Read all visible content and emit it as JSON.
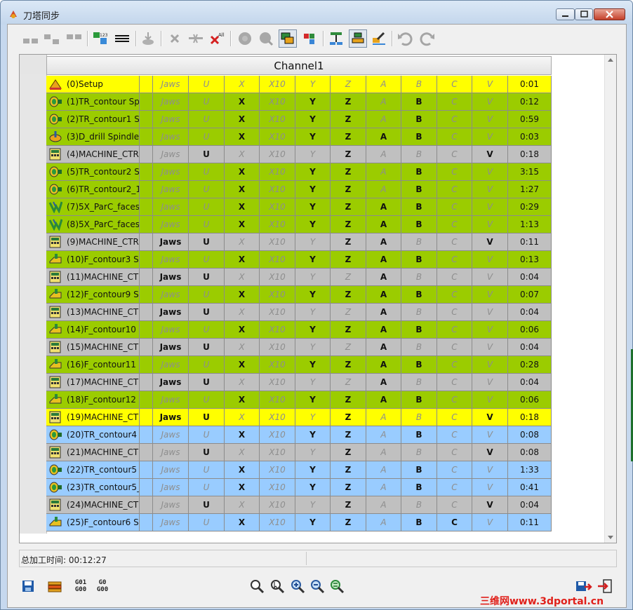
{
  "window": {
    "title": "刀塔同步"
  },
  "grid": {
    "channel_header": "Channel1",
    "rows": [
      {
        "color": "yellow",
        "icon": "setup-icon",
        "name": "(0)Setup",
        "cols": [
          "",
          "Jaws",
          "U",
          "X",
          "X10",
          "Y",
          "Z",
          "A",
          "B",
          "C",
          "V"
        ],
        "on": [
          0,
          0,
          0,
          0,
          0,
          0,
          0,
          0,
          0,
          0,
          0
        ],
        "time": "0:01"
      },
      {
        "color": "green",
        "icon": "turning-icon",
        "name": "(1)TR_contour  Sp",
        "cols": [
          "",
          "Jaws",
          "U",
          "X",
          "X10",
          "Y",
          "Z",
          "A",
          "B",
          "C",
          "V"
        ],
        "on": [
          0,
          0,
          0,
          1,
          0,
          1,
          1,
          0,
          1,
          0,
          0
        ],
        "time": "0:12"
      },
      {
        "color": "green",
        "icon": "turning-icon",
        "name": "(2)TR_contour1  S",
        "cols": [
          "",
          "Jaws",
          "U",
          "X",
          "X10",
          "Y",
          "Z",
          "A",
          "B",
          "C",
          "V"
        ],
        "on": [
          0,
          0,
          0,
          1,
          0,
          1,
          1,
          0,
          1,
          0,
          0
        ],
        "time": "0:59"
      },
      {
        "color": "green",
        "icon": "drill-icon",
        "name": "(3)D_drill  Spindle",
        "cols": [
          "",
          "Jaws",
          "U",
          "X",
          "X10",
          "Y",
          "Z",
          "A",
          "B",
          "C",
          "V"
        ],
        "on": [
          0,
          0,
          0,
          1,
          0,
          1,
          1,
          1,
          1,
          0,
          0
        ],
        "time": "0:03"
      },
      {
        "color": "gray",
        "icon": "machine-control-icon",
        "name": "(4)MACHINE_CTR",
        "cols": [
          "",
          "Jaws",
          "U",
          "X",
          "X10",
          "Y",
          "Z",
          "A",
          "B",
          "C",
          "V"
        ],
        "on": [
          0,
          0,
          1,
          0,
          0,
          0,
          1,
          0,
          0,
          0,
          1
        ],
        "time": "0:18"
      },
      {
        "color": "green",
        "icon": "turning-icon",
        "name": "(5)TR_contour2  S",
        "cols": [
          "",
          "Jaws",
          "U",
          "X",
          "X10",
          "Y",
          "Z",
          "A",
          "B",
          "C",
          "V"
        ],
        "on": [
          0,
          0,
          0,
          1,
          0,
          1,
          1,
          0,
          1,
          0,
          0
        ],
        "time": "3:15"
      },
      {
        "color": "green",
        "icon": "turning-icon",
        "name": "(6)TR_contour2_1",
        "cols": [
          "",
          "Jaws",
          "U",
          "X",
          "X10",
          "Y",
          "Z",
          "A",
          "B",
          "C",
          "V"
        ],
        "on": [
          0,
          0,
          0,
          1,
          0,
          1,
          1,
          0,
          1,
          0,
          0
        ],
        "time": "1:27"
      },
      {
        "color": "green",
        "icon": "five-axis-icon",
        "name": "(7)5X_ParC_faces",
        "cols": [
          "",
          "Jaws",
          "U",
          "X",
          "X10",
          "Y",
          "Z",
          "A",
          "B",
          "C",
          "V"
        ],
        "on": [
          0,
          0,
          0,
          1,
          0,
          1,
          1,
          1,
          1,
          0,
          0
        ],
        "time": "0:29"
      },
      {
        "color": "green",
        "icon": "five-axis-icon",
        "name": "(8)5X_ParC_faces",
        "cols": [
          "",
          "Jaws",
          "U",
          "X",
          "X10",
          "Y",
          "Z",
          "A",
          "B",
          "C",
          "V"
        ],
        "on": [
          0,
          0,
          0,
          1,
          0,
          1,
          1,
          1,
          1,
          0,
          0
        ],
        "time": "1:13"
      },
      {
        "color": "gray",
        "icon": "machine-control-icon",
        "name": "(9)MACHINE_CTR",
        "cols": [
          "",
          "Jaws",
          "U",
          "X",
          "X10",
          "Y",
          "Z",
          "A",
          "B",
          "C",
          "V"
        ],
        "on": [
          0,
          1,
          1,
          0,
          0,
          0,
          1,
          1,
          0,
          0,
          1
        ],
        "time": "0:11"
      },
      {
        "color": "green",
        "icon": "milling-icon",
        "name": "(10)F_contour3  S",
        "cols": [
          "",
          "Jaws",
          "U",
          "X",
          "X10",
          "Y",
          "Z",
          "A",
          "B",
          "C",
          "V"
        ],
        "on": [
          0,
          0,
          0,
          1,
          0,
          1,
          1,
          1,
          1,
          0,
          0
        ],
        "time": "0:13"
      },
      {
        "color": "gray",
        "icon": "machine-control-icon",
        "name": "(11)MACHINE_CT",
        "cols": [
          "",
          "Jaws",
          "U",
          "X",
          "X10",
          "Y",
          "Z",
          "A",
          "B",
          "C",
          "V"
        ],
        "on": [
          0,
          1,
          1,
          0,
          0,
          0,
          0,
          1,
          0,
          0,
          0
        ],
        "time": "0:04"
      },
      {
        "color": "green",
        "icon": "milling-icon",
        "name": "(12)F_contour9  S",
        "cols": [
          "",
          "Jaws",
          "U",
          "X",
          "X10",
          "Y",
          "Z",
          "A",
          "B",
          "C",
          "V"
        ],
        "on": [
          0,
          0,
          0,
          1,
          0,
          1,
          1,
          1,
          1,
          0,
          0
        ],
        "time": "0:07"
      },
      {
        "color": "gray",
        "icon": "machine-control-icon",
        "name": "(13)MACHINE_CT",
        "cols": [
          "",
          "Jaws",
          "U",
          "X",
          "X10",
          "Y",
          "Z",
          "A",
          "B",
          "C",
          "V"
        ],
        "on": [
          0,
          1,
          1,
          0,
          0,
          0,
          0,
          1,
          0,
          0,
          0
        ],
        "time": "0:04"
      },
      {
        "color": "green",
        "icon": "milling-icon",
        "name": "(14)F_contour10",
        "cols": [
          "",
          "Jaws",
          "U",
          "X",
          "X10",
          "Y",
          "Z",
          "A",
          "B",
          "C",
          "V"
        ],
        "on": [
          0,
          0,
          0,
          1,
          0,
          1,
          1,
          1,
          1,
          0,
          0
        ],
        "time": "0:06"
      },
      {
        "color": "gray",
        "icon": "machine-control-icon",
        "name": "(15)MACHINE_CT",
        "cols": [
          "",
          "Jaws",
          "U",
          "X",
          "X10",
          "Y",
          "Z",
          "A",
          "B",
          "C",
          "V"
        ],
        "on": [
          0,
          1,
          1,
          0,
          0,
          0,
          0,
          1,
          0,
          0,
          0
        ],
        "time": "0:04"
      },
      {
        "color": "green",
        "icon": "milling-icon",
        "name": "(16)F_contour11",
        "cols": [
          "",
          "Jaws",
          "U",
          "X",
          "X10",
          "Y",
          "Z",
          "A",
          "B",
          "C",
          "V"
        ],
        "on": [
          0,
          0,
          0,
          1,
          0,
          1,
          1,
          1,
          1,
          0,
          0
        ],
        "time": "0:28"
      },
      {
        "color": "gray",
        "icon": "machine-control-icon",
        "name": "(17)MACHINE_CT",
        "cols": [
          "",
          "Jaws",
          "U",
          "X",
          "X10",
          "Y",
          "Z",
          "A",
          "B",
          "C",
          "V"
        ],
        "on": [
          0,
          1,
          1,
          0,
          0,
          0,
          0,
          1,
          0,
          0,
          0
        ],
        "time": "0:04"
      },
      {
        "color": "green",
        "icon": "milling-icon",
        "name": "(18)F_contour12",
        "cols": [
          "",
          "Jaws",
          "U",
          "X",
          "X10",
          "Y",
          "Z",
          "A",
          "B",
          "C",
          "V"
        ],
        "on": [
          0,
          0,
          0,
          1,
          0,
          1,
          1,
          1,
          1,
          0,
          0
        ],
        "time": "0:06"
      },
      {
        "color": "yellow",
        "icon": "machine-control-icon",
        "name": "(19)MACHINE_CT",
        "cols": [
          "",
          "Jaws",
          "U",
          "X",
          "X10",
          "Y",
          "Z",
          "A",
          "B",
          "C",
          "V"
        ],
        "on": [
          0,
          1,
          1,
          0,
          0,
          0,
          1,
          0,
          0,
          0,
          1
        ],
        "time": "0:18"
      },
      {
        "color": "blue",
        "icon": "turning-icon",
        "name": "(20)TR_contour4",
        "cols": [
          "",
          "Jaws",
          "U",
          "X",
          "X10",
          "Y",
          "Z",
          "A",
          "B",
          "C",
          "V"
        ],
        "on": [
          0,
          0,
          0,
          1,
          0,
          1,
          1,
          0,
          1,
          0,
          0
        ],
        "time": "0:08"
      },
      {
        "color": "gray",
        "icon": "machine-control-icon",
        "name": "(21)MACHINE_CT",
        "cols": [
          "",
          "Jaws",
          "U",
          "X",
          "X10",
          "Y",
          "Z",
          "A",
          "B",
          "C",
          "V"
        ],
        "on": [
          0,
          0,
          1,
          0,
          0,
          0,
          1,
          0,
          0,
          0,
          1
        ],
        "time": "0:08"
      },
      {
        "color": "blue",
        "icon": "turning-icon",
        "name": "(22)TR_contour5",
        "cols": [
          "",
          "Jaws",
          "U",
          "X",
          "X10",
          "Y",
          "Z",
          "A",
          "B",
          "C",
          "V"
        ],
        "on": [
          0,
          0,
          0,
          1,
          0,
          1,
          1,
          0,
          1,
          0,
          0
        ],
        "time": "1:33"
      },
      {
        "color": "blue",
        "icon": "turning-icon",
        "name": "(23)TR_contour5_",
        "cols": [
          "",
          "Jaws",
          "U",
          "X",
          "X10",
          "Y",
          "Z",
          "A",
          "B",
          "C",
          "V"
        ],
        "on": [
          0,
          0,
          0,
          1,
          0,
          1,
          1,
          0,
          1,
          0,
          0
        ],
        "time": "0:41"
      },
      {
        "color": "gray",
        "icon": "machine-control-icon",
        "name": "(24)MACHINE_CT",
        "cols": [
          "",
          "Jaws",
          "U",
          "X",
          "X10",
          "Y",
          "Z",
          "A",
          "B",
          "C",
          "V"
        ],
        "on": [
          0,
          0,
          1,
          0,
          0,
          0,
          1,
          0,
          0,
          0,
          1
        ],
        "time": "0:04"
      },
      {
        "color": "blue",
        "icon": "milling-icon",
        "name": "(25)F_contour6  S",
        "cols": [
          "",
          "Jaws",
          "U",
          "X",
          "X10",
          "Y",
          "Z",
          "A",
          "B",
          "C",
          "V"
        ],
        "on": [
          0,
          0,
          0,
          1,
          0,
          1,
          1,
          0,
          1,
          1,
          0
        ],
        "time": "0:11"
      }
    ]
  },
  "status": {
    "total_time_label": "总加工时间: 00:12:27"
  },
  "bottom": {
    "gcode1": {
      "top": "G01",
      "bottom": "G00"
    },
    "gcode2": {
      "top": "G0",
      "bottom": "G00"
    }
  },
  "watermark": {
    "text": "三维网www.3dportal.cn"
  },
  "colors": {
    "yellow": "#ffff00",
    "green": "#9bcc00",
    "gray": "#c0c0c0",
    "blue": "#99ccff"
  }
}
